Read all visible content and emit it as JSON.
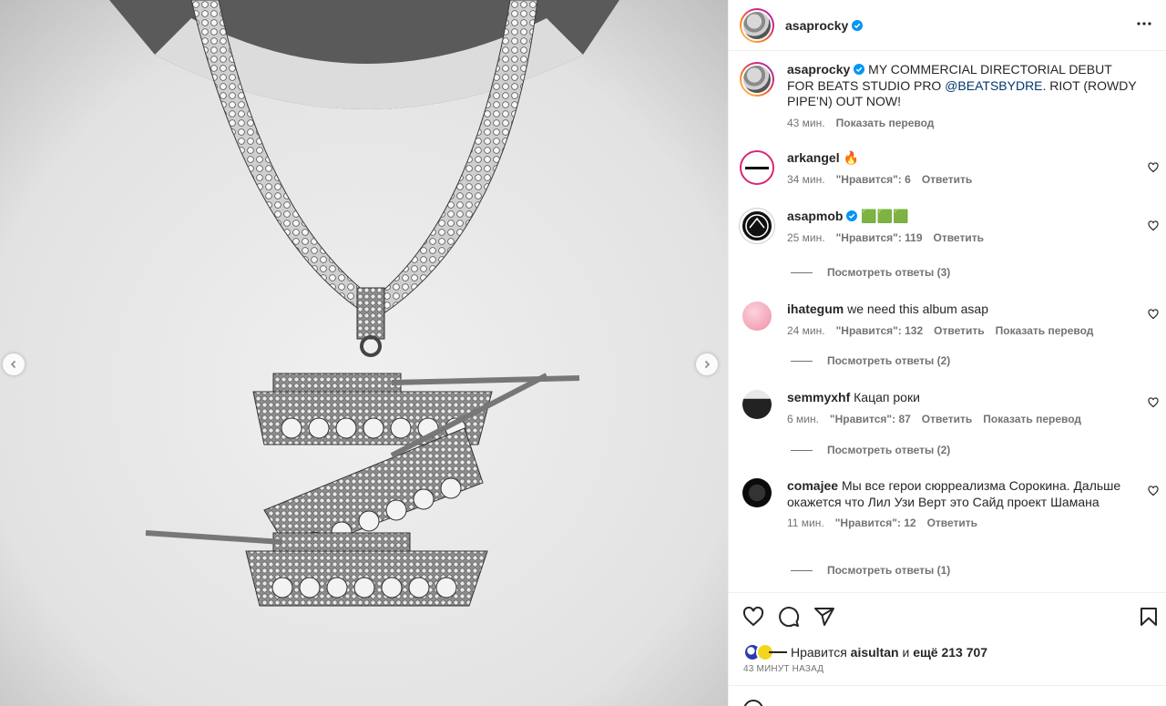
{
  "post": {
    "username": "asaprocky",
    "more_icon": "more-horizontal-icon"
  },
  "caption": {
    "username": "asaprocky",
    "text_before": "MY COMMERCIAL DIRECTORIAL DEBUT FOR BEATS STUDIO PRO ",
    "mention": "@BEATSBYDRE",
    "text_after": ". RIOT (ROWDY PIPE’N) OUT NOW!",
    "time": "43 мин.",
    "translate": "Показать перевод"
  },
  "comments": [
    {
      "username": "arkangel",
      "text": "🔥",
      "time": "34 мин.",
      "likes": "\"Нравится\": 6",
      "reply": "Ответить",
      "translate": "",
      "view_replies": "",
      "verified": false
    },
    {
      "username": "asapmob",
      "text": "🟩🟩🟩",
      "time": "25 мин.",
      "likes": "\"Нравится\": 119",
      "reply": "Ответить",
      "translate": "",
      "view_replies": "Посмотреть ответы (3)",
      "verified": true
    },
    {
      "username": "ihategum",
      "text": "we need this album asap",
      "time": "24 мин.",
      "likes": "\"Нравится\": 132",
      "reply": "Ответить",
      "translate": "Показать перевод",
      "view_replies": "Посмотреть ответы (2)",
      "verified": false
    },
    {
      "username": "semmyxhf",
      "text": "Кацап роки",
      "time": "6 мин.",
      "likes": "\"Нравится\": 87",
      "reply": "Ответить",
      "translate": "Показать перевод",
      "view_replies": "Посмотреть ответы (2)",
      "verified": false
    },
    {
      "username": "comajee",
      "text": "Мы все герои сюрреализма Сорокина. Дальше окажется что Лил Узи Верт это Сайд проект Шамана",
      "time": "11 мин.",
      "likes": "\"Нравится\": 12",
      "reply": "Ответить",
      "translate": "",
      "view_replies": "Посмотреть ответы (1)",
      "verified": false
    }
  ],
  "footer": {
    "likes_prefix": "Нравится",
    "likes_user": "aisultan",
    "likes_conj": "и",
    "likes_rest": "ещё 213 707",
    "time_ago": "43 МИНУТ НАЗАД"
  },
  "colors": {
    "verified": "#0095f6",
    "mention": "#00376b",
    "muted": "#737373"
  }
}
